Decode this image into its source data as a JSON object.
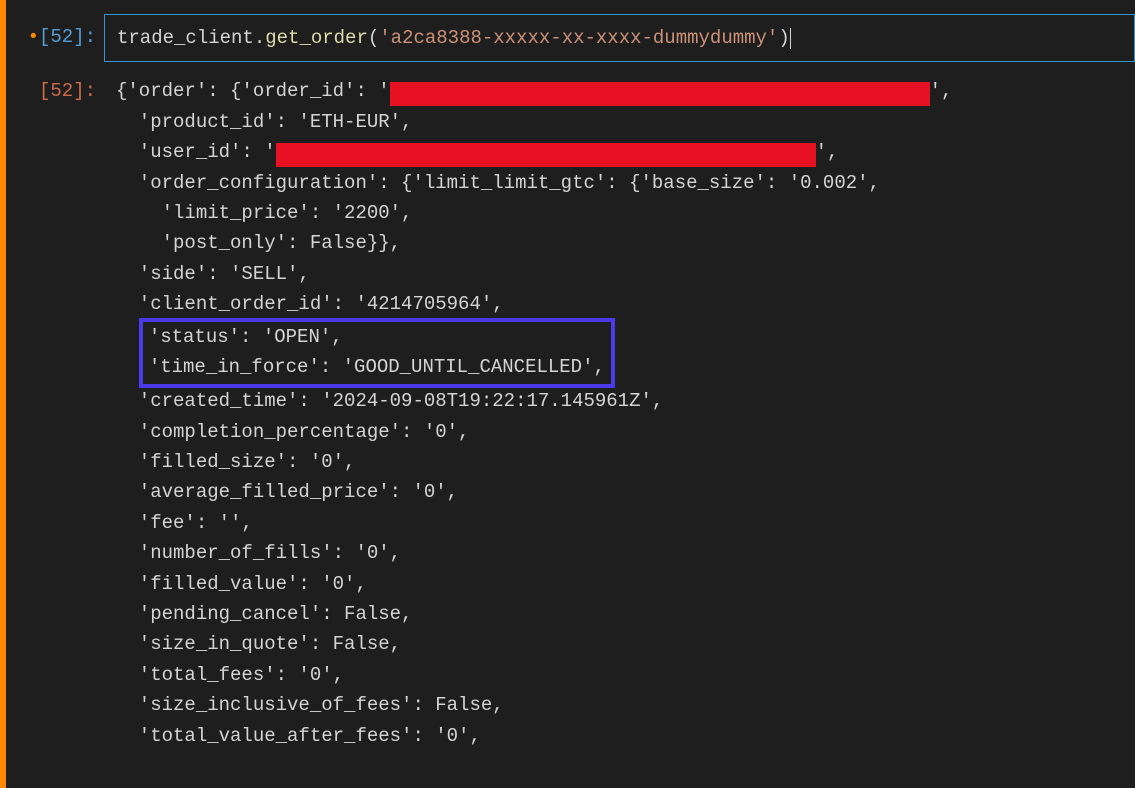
{
  "input": {
    "bullet": "•",
    "label": "[52]:",
    "code": {
      "client": "trade_client",
      "dot": ".",
      "method": "get_order",
      "open": "(",
      "arg": "'a2ca8388-xxxxx-xx-xxxx-dummydummy'",
      "close": ")"
    }
  },
  "output": {
    "label": "[52]:",
    "lines": {
      "l1a": "{'order': {'order_id': '",
      "l1b": "',",
      "l2": "  'product_id': 'ETH-EUR',",
      "l3a": "  'user_id': '",
      "l3b": "',",
      "l4": "  'order_configuration': {'limit_limit_gtc': {'base_size': '0.002',",
      "l5": "    'limit_price': '2200',",
      "l6": "    'post_only': False}},",
      "l7": "  'side': 'SELL',",
      "l8": "  'client_order_id': '4214705964',",
      "h1": "'status': 'OPEN',",
      "h2": "'time_in_force': 'GOOD_UNTIL_CANCELLED',",
      "l11": "  'created_time': '2024-09-08T19:22:17.145961Z',",
      "l12": "  'completion_percentage': '0',",
      "l13": "  'filled_size': '0',",
      "l14": "  'average_filled_price': '0',",
      "l15": "  'fee': '',",
      "l16": "  'number_of_fills': '0',",
      "l17": "  'filled_value': '0',",
      "l18": "  'pending_cancel': False,",
      "l19": "  'size_in_quote': False,",
      "l20": "  'total_fees': '0',",
      "l21": "  'size_inclusive_of_fees': False,",
      "l22": "  'total_value_after_fees': '0',"
    }
  }
}
